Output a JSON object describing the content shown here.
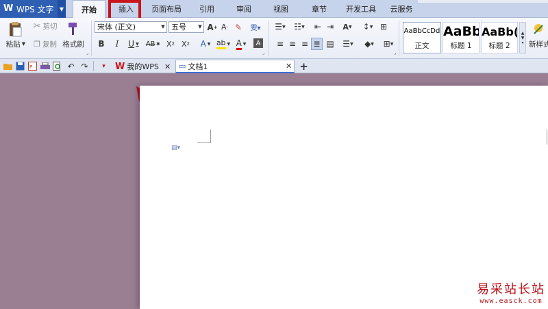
{
  "app": {
    "title": "WPS 文字"
  },
  "menu": {
    "tabs": [
      "开始",
      "插入",
      "页面布局",
      "引用",
      "审阅",
      "视图",
      "章节",
      "开发工具",
      "云服务"
    ],
    "active": "开始",
    "highlighted": "插入"
  },
  "ribbon": {
    "paste": "粘贴",
    "cut": "剪切",
    "copy": "复制",
    "format_painter": "格式刷",
    "font_name": "宋体 (正文)",
    "font_size": "五号",
    "styles": [
      {
        "preview": "AaBbCcDd",
        "label": "正文"
      },
      {
        "preview": "AaBb",
        "label": "标题 1"
      },
      {
        "preview": "AaBb(",
        "label": "标题 2"
      }
    ],
    "new_style": "新样式"
  },
  "doc_tabs": [
    {
      "label": "我的WPS",
      "active": false
    },
    {
      "label": "文档1",
      "active": true
    }
  ],
  "watermark": {
    "line1": "易采站长站",
    "line2": "www.easck.com"
  },
  "colors": {
    "accent": "#2f5fb3",
    "highlight": "#c8141a",
    "background": "#9a7f93"
  }
}
